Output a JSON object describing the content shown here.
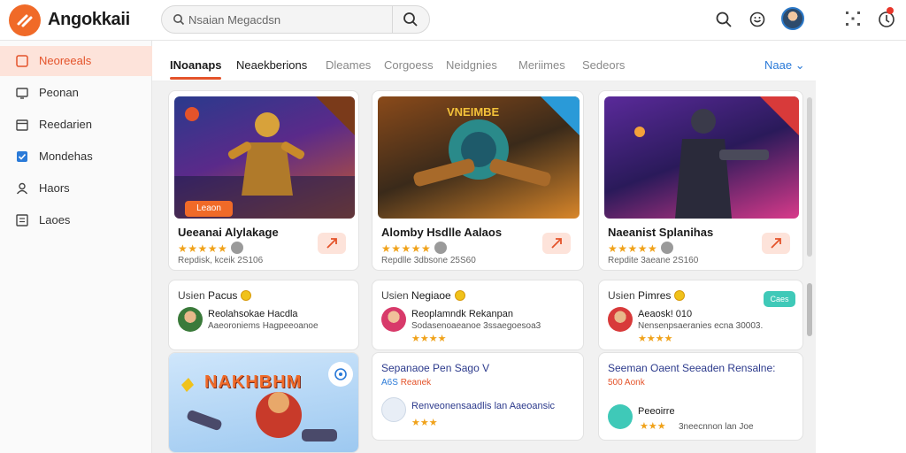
{
  "app": {
    "name": "Angokkaii"
  },
  "search": {
    "placeholder": "Nsaian Megacdsn"
  },
  "sidebar": {
    "items": [
      {
        "label": "Neoreeals",
        "icon": "grid-icon",
        "active": true
      },
      {
        "label": "Peonan",
        "icon": "monitor-icon",
        "active": false
      },
      {
        "label": "Reedarien",
        "icon": "calendar-icon",
        "active": false
      },
      {
        "label": "Mondehas",
        "icon": "checkbox-icon",
        "active": false
      },
      {
        "label": "Haors",
        "icon": "user-icon",
        "active": false
      },
      {
        "label": "Laoes",
        "icon": "list-icon",
        "active": false
      }
    ]
  },
  "tabs": [
    {
      "label": "INoanaps",
      "active": true
    },
    {
      "label": "Neaekberions"
    },
    {
      "label": "Dleames"
    },
    {
      "label": "Corgoess"
    },
    {
      "label": "Neidgnies"
    },
    {
      "label": "Meriimes"
    },
    {
      "label": "Sedeors"
    }
  ],
  "tabs_more": "Naae",
  "cards": [
    {
      "title": "Ueeanai Alylakage",
      "meta": "Repdisk, kceik 2S106",
      "stars": "★★★★★",
      "play": "Leaon"
    },
    {
      "title": "Alomby Hsdlle Aalaos",
      "meta": "Repdlle 3dbsone 25S60",
      "stars": "★★★★★",
      "art_title": "VNEIMBE"
    },
    {
      "title": "Naeanist Splanihas",
      "meta": "Repdite 3aeane 2S160",
      "stars": "★★★★★"
    }
  ],
  "small_cards": [
    {
      "head_pre": "Usien",
      "head": "Pacus",
      "title": "Reolahsokae Hacdla",
      "sub": "Aaeoroniems Hagpeeoanoe",
      "stars": ""
    },
    {
      "head_pre": "Usien",
      "head": "Negiaoe",
      "title": "Reoplamndk Rekanpan",
      "sub": "Sodasenoaeanoe 3ssaegoesoa3",
      "stars": "★★★★"
    },
    {
      "head_pre": "Usien",
      "head": "Pimres",
      "title": "Aeaosk! 010",
      "sub": "Nensenpsaeranies ecna 30003.",
      "stars": "★★★★",
      "btn": "Caes"
    }
  ],
  "lower_cards": [
    {
      "art_title": "NAKHBHM"
    },
    {
      "title": "Sepanaoe Pen Sago V",
      "sub_a": "A6S",
      "sub_b": "Reanek",
      "row": "Renveonensaadlis lan Aaeoansic",
      "stars": "★★★"
    },
    {
      "title": "Seeman Oaent Seeaden Rensalne:",
      "sub_a": "500",
      "sub_b": "Aonk",
      "row_title": "Peeoirre",
      "row": "3neecnnon lan Joe",
      "stars": "★★★"
    }
  ],
  "colors": {
    "accent": "#f06a28",
    "link": "#2a7ad8",
    "star": "#f0a21a",
    "teal": "#3fc9b8"
  }
}
